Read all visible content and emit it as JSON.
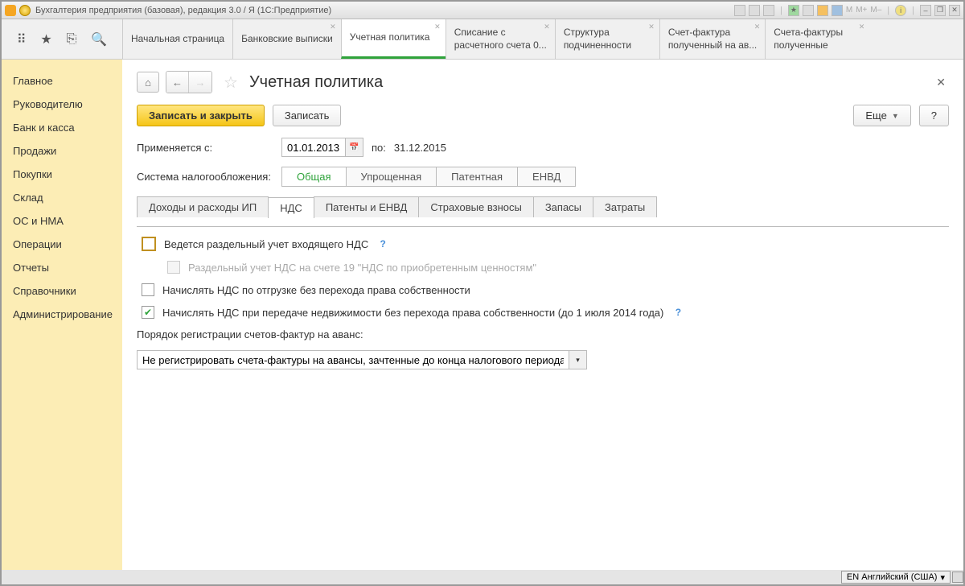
{
  "titlebar": {
    "title": "Бухгалтерия предприятия (базовая), редакция 3.0 / Я  (1С:Предприятие)",
    "m": "M",
    "mplus": "M+",
    "mminus": "M–"
  },
  "apptabs": {
    "tools": {
      "apps": "⠿",
      "star": "★",
      "pin": "⎘",
      "search": "🔍"
    },
    "items": [
      {
        "label": "Начальная страница"
      },
      {
        "label": "Банковские выписки"
      },
      {
        "label": "Учетная политика",
        "active": true
      },
      {
        "label": "Списание с\nрасчетного счета 0..."
      },
      {
        "label": "Структура\nподчиненности"
      },
      {
        "label": "Счет-фактура\nполученный на ав..."
      },
      {
        "label": "Счета-фактуры\nполученные"
      }
    ]
  },
  "sidebar": {
    "items": [
      "Главное",
      "Руководителю",
      "Банк и касса",
      "Продажи",
      "Покупки",
      "Склад",
      "ОС и НМА",
      "Операции",
      "Отчеты",
      "Справочники",
      "Администрирование"
    ]
  },
  "page": {
    "title": "Учетная политика",
    "save_close": "Записать и закрыть",
    "save": "Записать",
    "more": "Еще",
    "help": "?",
    "applies_from": "Применяется с:",
    "date_from": "01.01.2013",
    "to": "по:",
    "date_to": "31.12.2015",
    "tax_system": "Система налогообложения:",
    "tax_options": [
      "Общая",
      "Упрощенная",
      "Патентная",
      "ЕНВД"
    ],
    "subtabs": [
      "Доходы и расходы ИП",
      "НДС",
      "Патенты и ЕНВД",
      "Страховые взносы",
      "Запасы",
      "Затраты"
    ],
    "chk1": "Ведется раздельный учет входящего НДС",
    "chk2": "Раздельный учет НДС на счете 19 \"НДС по приобретенным ценностям\"",
    "chk3": "Начислять НДС по отгрузке без перехода права собственности",
    "chk4": "Начислять НДС при передаче недвижимости без перехода права собственности (до 1 июля 2014 года)",
    "advlabel": "Порядок регистрации счетов-фактур на аванс:",
    "advvalue": "Не регистрировать счета-фактуры на авансы, зачтенные до конца налогового периода",
    "q": "?"
  },
  "status": {
    "lang": "EN Английский (США)"
  }
}
